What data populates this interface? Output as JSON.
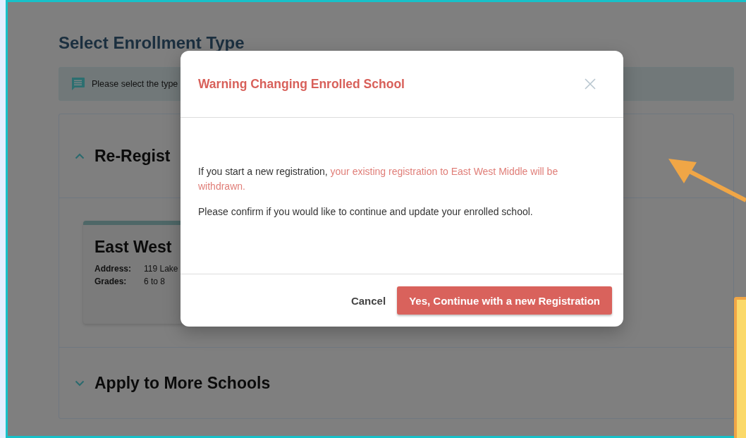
{
  "page": {
    "title": "Select Enrollment Type",
    "notice": "Please select the type",
    "sections": [
      {
        "title": "Re-Regist",
        "expanded": true,
        "schools": [
          {
            "name": "East West",
            "fields": [
              {
                "label": "Address:",
                "value": "119 Lake"
              },
              {
                "label": "Grades:",
                "value": "6 to 8"
              }
            ]
          }
        ]
      },
      {
        "title": "Apply to More Schools",
        "expanded": false
      }
    ]
  },
  "dialog": {
    "title": "Warning Changing Enrolled School",
    "paragraphs": [
      [
        {
          "text": "If you start a new registration, ",
          "highlight": false
        },
        {
          "text": "your existing registration to East West Middle will be withdrawn.",
          "highlight": true
        }
      ],
      [
        {
          "text": "Please confirm if you would like to continue and update your enrolled school.",
          "highlight": false
        }
      ]
    ],
    "buttons": [
      {
        "label": "Cancel",
        "kind": "text"
      },
      {
        "label": "Yes, Continue with a new Registration",
        "kind": "primary"
      }
    ]
  }
}
